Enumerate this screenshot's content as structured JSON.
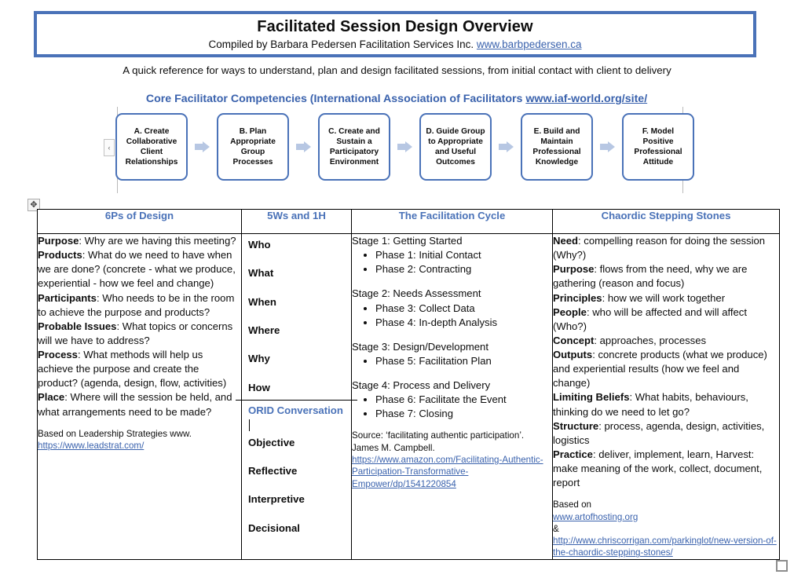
{
  "header": {
    "title": "Facilitated Session Design Overview",
    "compiled_prefix": "Compiled by Barbara Pedersen Facilitation Services Inc. ",
    "compiled_link": "www.barbpedersen.ca",
    "tagline": "A quick reference for ways to understand, plan and design facilitated sessions, from initial contact with client to delivery"
  },
  "competencies": {
    "title_prefix": "Core Facilitator Competencies (International Association of Facilitators ",
    "title_link": "www.iaf-world.org/site/",
    "expand_label": "‹",
    "boxes": [
      "A. Create Collaborative Client Relationships",
      "B. Plan Appropriate Group Processes",
      "C. Create and Sustain a Participatory Environment",
      "D. Guide Group to Appropriate and Useful Outcomes",
      "E. Build and Maintain Professional Knowledge",
      "F. Model Positive Professional Attitude"
    ]
  },
  "table": {
    "headers": [
      "6Ps of Design",
      "5Ws and 1H",
      "The Facilitation Cycle",
      "Chaordic Stepping Stones"
    ],
    "col1": {
      "items": [
        {
          "label": "Purpose",
          "text": ": Why are we having this meeting?"
        },
        {
          "label": "Products",
          "text": ": What do we need to have when we are done? (concrete - what we produce, experiential - how we feel and change)"
        },
        {
          "label": "Participants",
          "text": ": Who needs to be in the room to achieve the purpose and products?"
        },
        {
          "label": "Probable Issues",
          "text": ": What topics or concerns will we have to address?"
        },
        {
          "label": "Process",
          "text": ": What methods will help us achieve the purpose and create the product? (agenda, design, flow, activities)"
        },
        {
          "label": "Place",
          "text": ": Where will the session be held, and what arrangements need to be made?"
        }
      ],
      "source_text": "Based on Leadership Strategies www.",
      "source_link": "https://www.leadstrat.com/"
    },
    "col2": {
      "ws": [
        "Who",
        "What",
        "When",
        "Where",
        "Why",
        "How"
      ],
      "orid_title": "ORID Conversation",
      "orid": [
        "Objective",
        "Reflective",
        "Interpretive",
        "Decisional"
      ]
    },
    "col3": {
      "stages": [
        {
          "title": "Stage 1: Getting Started",
          "phases": [
            "Phase 1: Initial Contact",
            "Phase 2: Contracting"
          ]
        },
        {
          "title": "Stage 2: Needs Assessment",
          "phases": [
            "Phase 3: Collect Data",
            "Phase 4: In-depth Analysis"
          ]
        },
        {
          "title": "Stage 3: Design/Development",
          "phases": [
            "Phase 5: Facilitation Plan"
          ]
        },
        {
          "title": "Stage 4: Process and Delivery",
          "phases": [
            "Phase 6: Facilitate the Event",
            "Phase 7: Closing"
          ]
        }
      ],
      "source_line1": "Source: ‘facilitating authentic participation’.",
      "source_line2": "James M. Campbell.",
      "source_link": "https://www.amazon.com/Facilitating-Authentic-Participation-Transformative-Empower/dp/1541220854"
    },
    "col4": {
      "items": [
        {
          "label": "Need",
          "text": ": compelling reason for doing the session (Why?)"
        },
        {
          "label": "Purpose",
          "text": ": flows from the need, why we are gathering (reason and focus)"
        },
        {
          "label": "Principles",
          "text": ": how we will work together"
        },
        {
          "label": "People",
          "text": ": who will be affected and will affect (Who?)"
        },
        {
          "label": "Concept",
          "text": ": approaches, processes"
        },
        {
          "label": "Outputs",
          "text": ": concrete products (what we produce) and experiential results (how we feel and change)"
        },
        {
          "label": "Limiting Beliefs",
          "text": ": What habits, behaviours, thinking do we need to let go?"
        },
        {
          "label": "Structure",
          "text": ": process, agenda, design, activities, logistics"
        },
        {
          "label": "Practice",
          "text": ": deliver, implement, learn, Harvest: make meaning of the work, collect, document, report"
        }
      ],
      "source_prefix": "Based on ",
      "source_link1": "www.artofhosting.org",
      "source_mid": " &",
      "source_link2": "http://www.chriscorrigan.com/parkinglot/new-version-of-the-chaordic-stepping-stones/"
    }
  },
  "colors": {
    "accent_blue": "#4a72b8",
    "link_blue": "#3a62ad",
    "arrow_blue": "#b7c7e3"
  }
}
